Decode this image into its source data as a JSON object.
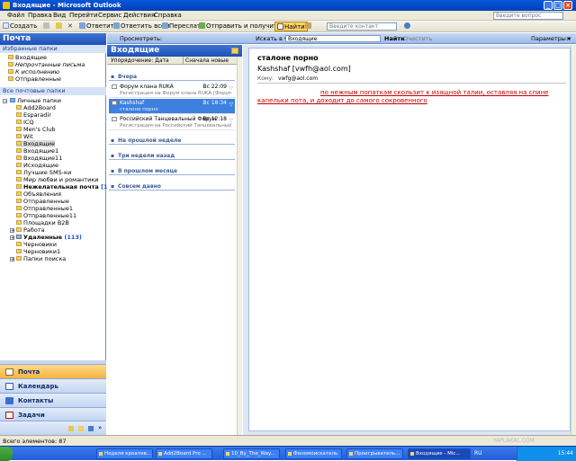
{
  "window": {
    "title": "Входящие - Microsoft Outlook",
    "min": "_",
    "max": "□",
    "close": "×"
  },
  "menu": [
    "Файл",
    "Правка",
    "Вид",
    "Перейти",
    "Сервис",
    "Действия",
    "Справка"
  ],
  "ask_question_placeholder": "Введите вопрос",
  "toolbar": {
    "create": "Создать",
    "reply": "Ответить",
    "reply_all": "Ответить всем",
    "forward": "Переслать",
    "send_receive": "Отправить и получить",
    "find": "Найти",
    "contact_placeholder": "Введите контакт"
  },
  "nav": {
    "header": "Почта",
    "favorites_header": "Избранные папки",
    "favorites": [
      "Входящие",
      "Непрочтанные письма",
      "К исполнению",
      "Отправленные"
    ],
    "all_folders_header": "Все почтовые папки",
    "root": "Личные папки",
    "folders": [
      "Add2Board",
      "Esparadir",
      "ICQ",
      "Men's Club",
      "Wit",
      "Входящие",
      "Входящие1",
      "Входящие11",
      "Исходящие",
      "Лучшие SMS-ки",
      "Мир любви и романтики"
    ],
    "junk": {
      "label": "Нежелательная почта",
      "count": "[1]"
    },
    "folders2": [
      "Объявления",
      "Отправленные",
      "Отправленные1",
      "Отправленные11",
      "Площадки B2B",
      "Работа"
    ],
    "deleted": {
      "label": "Удаленные",
      "count": "(113)"
    },
    "folders3": [
      "Черновики",
      "Черновики1",
      "Папки поиска"
    ],
    "buttons": [
      "Почта",
      "Календарь",
      "Контакты",
      "Задачи"
    ]
  },
  "viewbar": {
    "view": "Просмотреть:",
    "search_in": "Искать в ▾",
    "search_value": "Входящие",
    "find": "Найти",
    "clear": "Очистить",
    "options": "Параметры ▾"
  },
  "list": {
    "header": "Входящие",
    "arrange_by": "Упорядочение: Дата",
    "sort": "Сначала новые",
    "groups": [
      "Вчера",
      "На прошлой неделе",
      "Три недели назад",
      "В прошлом месяце",
      "Совсем давно"
    ],
    "messages": [
      {
        "from": "Форум клана RUKA",
        "date": "Вс 22:09",
        "preview": "Регистрация на Форум клана RUKA [Форум..."
      },
      {
        "from": "Kashshaf",
        "date": "Вс 18:34",
        "preview": "сталоне порно"
      },
      {
        "from": "Российский Танцевальный Форум",
        "date": "Вс 12:18",
        "preview": "Регистрация на Российский Танцевальный..."
      }
    ]
  },
  "reading": {
    "subject": "сталоне порно",
    "sender": "Kashshaf [vwfh@aol.com]",
    "to_label": "Кому:",
    "to_value": "vwfg@aol.com",
    "body": "по нежным попаткам скользит к изящной талии, оставляя на спине капельки пота, и доходит до самого сокровенного"
  },
  "status": "Всего элементов: 87",
  "taskbar": {
    "items": [
      "Неделя креатив...",
      "Add2Board Pro ...",
      "10_By_The_Way...",
      "Феномоискатель",
      "Проигрыватель...",
      "Входящие - Mic..."
    ],
    "lang": "RU",
    "clock": "15:44"
  },
  "watermark": "YAPLAKAL.COM"
}
